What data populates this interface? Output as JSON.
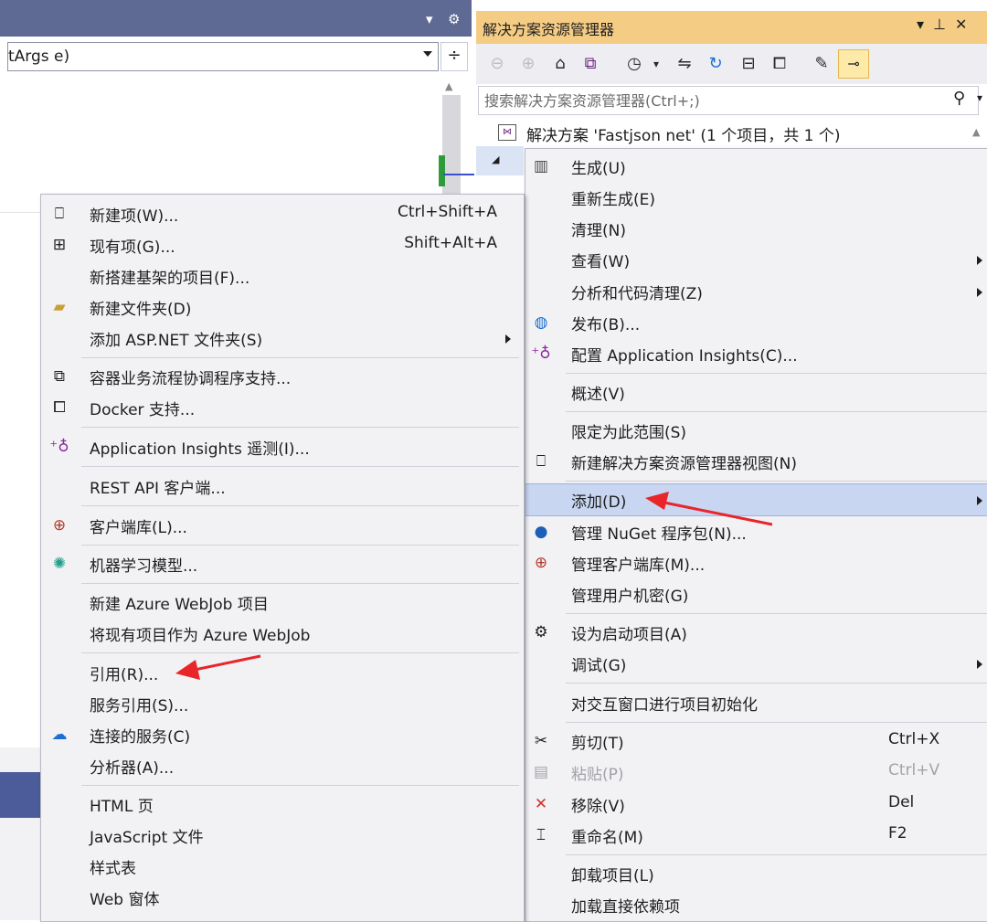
{
  "editor": {
    "method_dropdown": "tArgs e)"
  },
  "solution_explorer": {
    "title": "解决方案资源管理器",
    "search_placeholder": "搜索解决方案资源管理器(Ctrl+;)",
    "solution_label": "解决方案 'Fastjson net' (1 个项目，共 1 个)"
  },
  "add_menu": {
    "new_item": {
      "label": "新建项(W)...",
      "shortcut": "Ctrl+Shift+A"
    },
    "existing_item": {
      "label": "现有项(G)...",
      "shortcut": "Shift+Alt+A"
    },
    "new_scaffold": "新搭建基架的项目(F)...",
    "new_folder": "新建文件夹(D)",
    "add_aspnet_folder": "添加 ASP.NET 文件夹(S)",
    "container_orchestrator": "容器业务流程协调程序支持...",
    "docker_support": "Docker 支持...",
    "app_insights_telemetry": "Application Insights 遥测(I)...",
    "rest_api_client": "REST API 客户端...",
    "client_library": "客户端库(L)...",
    "ml_model": "机器学习模型...",
    "new_azure_webjob": "新建 Azure WebJob 项目",
    "existing_as_webjob": "将现有项目作为 Azure WebJob",
    "reference": "引用(R)...",
    "service_reference": "服务引用(S)...",
    "connected_service": "连接的服务(C)",
    "analyzer": "分析器(A)...",
    "html_page": "HTML 页",
    "javascript_file": "JavaScript 文件",
    "style_sheet": "样式表",
    "web_form": "Web 窗体"
  },
  "context_menu": {
    "build": "生成(U)",
    "rebuild": "重新生成(E)",
    "clean": "清理(N)",
    "view": "查看(W)",
    "analyze": "分析和代码清理(Z)",
    "publish": "发布(B)...",
    "configure_app_insights": "配置 Application Insights(C)...",
    "overview": "概述(V)",
    "scope_to_this": "限定为此范围(S)",
    "new_se_view": "新建解决方案资源管理器视图(N)",
    "add": "添加(D)",
    "manage_nuget": "管理 NuGet 程序包(N)...",
    "manage_client_libs": "管理客户端库(M)...",
    "manage_user_secrets": "管理用户机密(G)",
    "set_startup": "设为启动项目(A)",
    "debug": "调试(G)",
    "init_interactive": "对交互窗口进行项目初始化",
    "cut": {
      "label": "剪切(T)",
      "shortcut": "Ctrl+X"
    },
    "paste": {
      "label": "粘贴(P)",
      "shortcut": "Ctrl+V"
    },
    "remove": {
      "label": "移除(V)",
      "shortcut": "Del"
    },
    "rename": {
      "label": "重命名(M)",
      "shortcut": "F2"
    },
    "unload": "卸载项目(L)",
    "load_direct_deps": "加载直接依赖项"
  },
  "colors": {
    "editor_header": "#5e6a94",
    "se_title_bar": "#f5cc84",
    "menu_bg": "#f2f2f5",
    "highlight": "#c9d6f2",
    "annotation_arrow": "#e8262a"
  }
}
